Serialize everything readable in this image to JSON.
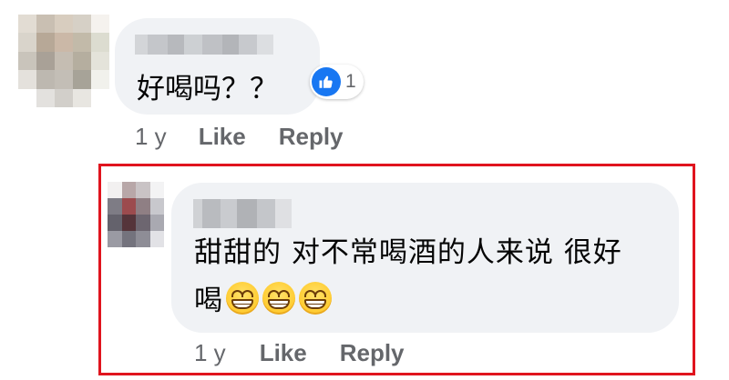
{
  "icons": {
    "like": "thumbs-up-icon",
    "emoji": "grinning-face-with-smiling-eyes-icon"
  },
  "colors": {
    "bubble": "#f0f2f5",
    "meta_text": "#65676b",
    "like_blue": "#1877f2",
    "highlight_border": "#e0141e"
  },
  "comment": {
    "text": "好喝吗？？",
    "reaction_count": "1",
    "time": "1 y",
    "like_label": "Like",
    "reply_label": "Reply"
  },
  "reply": {
    "line1": "甜甜的 对不常喝酒的人来说 很好",
    "line2": "喝",
    "emoji_count": 3,
    "time": "1 y",
    "like_label": "Like",
    "reply_label": "Reply"
  }
}
